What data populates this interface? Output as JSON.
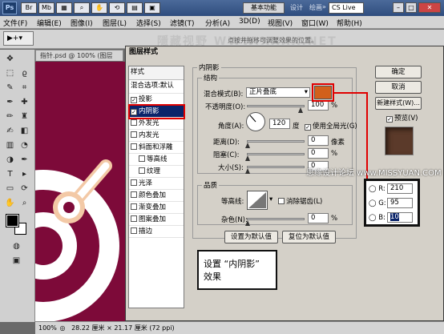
{
  "titlebar": {
    "logo": "Ps",
    "essential": "基本功能",
    "workspaces": [
      "设计",
      "绘画"
    ],
    "more": "»",
    "cs_live": "CS Live"
  },
  "menubar": {
    "items": [
      "文件(F)",
      "编辑(E)",
      "图像(I)",
      "图层(L)",
      "选择(S)",
      "滤镜(T)",
      "分析(A)",
      "3D(D)",
      "视图(V)",
      "窗口(W)",
      "帮助(H)"
    ]
  },
  "optbar": {
    "hint": "点按并拖移可调整效果的位置。"
  },
  "document": {
    "tab": "指针.psd @ 100% (图层",
    "status_zoom": "100%",
    "status_info": "28.22 厘米 × 21.17 厘米 (72 ppi)"
  },
  "dialog": {
    "title": "图层样式",
    "styles_header": "样式",
    "blend_default": "混合选项:默认",
    "styles": [
      {
        "label": "投影",
        "checked": true,
        "selected": false
      },
      {
        "label": "内阴影",
        "checked": true,
        "selected": true
      },
      {
        "label": "外发光",
        "checked": false,
        "selected": false
      },
      {
        "label": "内发光",
        "checked": false,
        "selected": false
      },
      {
        "label": "斜面和浮雕",
        "checked": false,
        "selected": false
      },
      {
        "label": "等高线",
        "checked": false,
        "selected": false,
        "indent": true
      },
      {
        "label": "纹理",
        "checked": false,
        "selected": false,
        "indent": true
      },
      {
        "label": "光泽",
        "checked": false,
        "selected": false
      },
      {
        "label": "颜色叠加",
        "checked": false,
        "selected": false
      },
      {
        "label": "渐变叠加",
        "checked": false,
        "selected": false
      },
      {
        "label": "图案叠加",
        "checked": false,
        "selected": false
      },
      {
        "label": "描边",
        "checked": false,
        "selected": false
      }
    ],
    "section_title": "内阴影",
    "structure": "结构",
    "blend_mode_label": "混合模式(B):",
    "blend_mode_value": "正片叠底",
    "shadow_color": "#d2601b",
    "opacity_label": "不透明度(O):",
    "opacity_value": "100",
    "angle_label": "角度(A):",
    "angle_value": "120",
    "degree": "度",
    "global_light": "使用全局光(G)",
    "distance_label": "距离(D):",
    "distance_value": "0",
    "choke_label": "阻塞(C):",
    "choke_value": "0",
    "size_label": "大小(S):",
    "size_value": "0",
    "px": "像素",
    "pct": "%",
    "quality": "品质",
    "contour_label": "等高线:",
    "anti_alias": "消除锯齿(L)",
    "noise_label": "杂色(N):",
    "noise_value": "0",
    "make_default": "设置为默认值",
    "reset_default": "复位为默认值",
    "ok": "确定",
    "cancel": "取消",
    "new_style": "新建样式(W)...",
    "preview": "预览(V)"
  },
  "rgb": {
    "r_label": "R:",
    "r": "210",
    "g_label": "G:",
    "g": "95",
    "b_label": "B:",
    "b": "10"
  },
  "note": {
    "line1": "设置 “内阴影”",
    "line2": "效果"
  },
  "watermark_site": "思缘设计论坛 www.MISSYUAN.COM",
  "watermark_top": "隱藏视野 WWW.XXXX.NET"
}
